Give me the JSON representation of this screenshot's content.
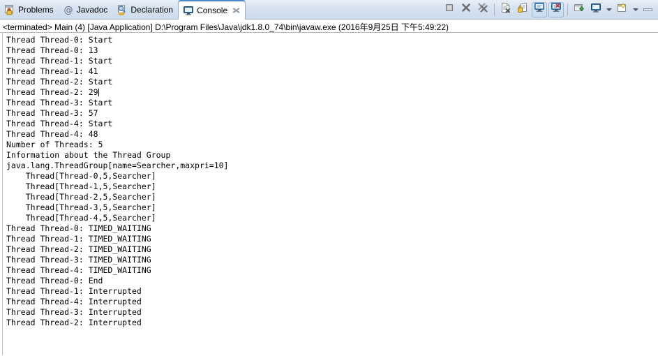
{
  "tabs": [
    {
      "label": "Problems",
      "icon": "problems-icon",
      "active": false,
      "closable": false
    },
    {
      "label": "Javadoc",
      "icon": "javadoc-icon",
      "active": false,
      "closable": false
    },
    {
      "label": "Declaration",
      "icon": "declaration-icon",
      "active": false,
      "closable": false
    },
    {
      "label": "Console",
      "icon": "console-icon",
      "active": true,
      "closable": true
    }
  ],
  "toolbar": {
    "buttons": [
      {
        "name": "terminate-button",
        "title": "Terminate",
        "pressed": false
      },
      {
        "name": "remove-launch-button",
        "title": "Remove Launch",
        "pressed": false
      },
      {
        "name": "remove-all-terminated-launches-button",
        "title": "Remove All Terminated Launches",
        "pressed": false
      },
      {
        "name": "clear-console-button",
        "title": "Clear Console",
        "pressed": false
      },
      {
        "name": "scroll-lock-button",
        "title": "Scroll Lock",
        "pressed": false
      },
      {
        "name": "show-console-on-output-button",
        "title": "Show Console When Standard Out Changes",
        "pressed": true
      },
      {
        "name": "show-console-on-error-button",
        "title": "Show Console When Standard Error Changes",
        "pressed": true
      },
      {
        "name": "pin-console-button",
        "title": "Pin Console",
        "pressed": false
      },
      {
        "name": "display-selected-console-button",
        "title": "Display Selected Console",
        "pressed": false
      },
      {
        "name": "open-console-button",
        "title": "Open Console",
        "pressed": false
      }
    ],
    "minimize_label": "Minimize",
    "view_menu_label": "View Menu"
  },
  "console": {
    "header": "<terminated> Main (4) [Java Application] D:\\Program Files\\Java\\jdk1.8.0_74\\bin\\javaw.exe (2016年9月25日 下午5:49:22)",
    "caret_line_index": 5,
    "lines": [
      "Thread Thread-0: Start",
      "Thread Thread-0: 13",
      "Thread Thread-1: Start",
      "Thread Thread-1: 41",
      "Thread Thread-2: Start",
      "Thread Thread-2: 29",
      "Thread Thread-3: Start",
      "Thread Thread-3: 57",
      "Thread Thread-4: Start",
      "Thread Thread-4: 48",
      "Number of Threads: 5",
      "Information about the Thread Group",
      "java.lang.ThreadGroup[name=Searcher,maxpri=10]",
      "    Thread[Thread-0,5,Searcher]",
      "    Thread[Thread-1,5,Searcher]",
      "    Thread[Thread-2,5,Searcher]",
      "    Thread[Thread-3,5,Searcher]",
      "    Thread[Thread-4,5,Searcher]",
      "Thread Thread-0: TIMED_WAITING",
      "Thread Thread-1: TIMED_WAITING",
      "Thread Thread-2: TIMED_WAITING",
      "Thread Thread-3: TIMED_WAITING",
      "Thread Thread-4: TIMED_WAITING",
      "Thread Thread-0: End",
      "Thread Thread-1: Interrupted",
      "Thread Thread-4: Interrupted",
      "Thread Thread-3: Interrupted",
      "Thread Thread-2: Interrupted"
    ]
  },
  "colors": {
    "tabbar_bg": "#d6e2f0",
    "active_tab_border": "#4a87c9",
    "console_bg": "#ffffff",
    "text": "#000000",
    "separator": "#b8b8b8"
  }
}
